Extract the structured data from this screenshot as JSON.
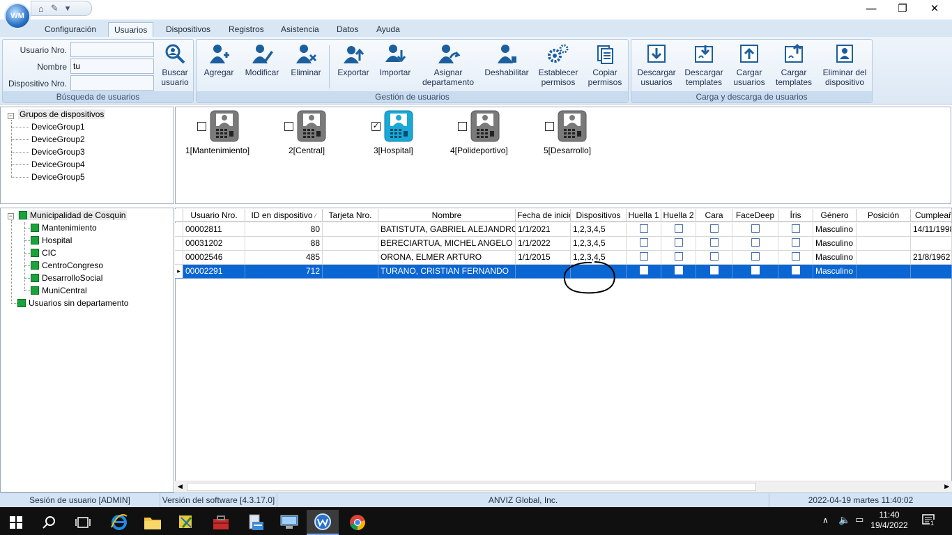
{
  "app": {
    "logo_text": "WM",
    "qat_icons": [
      "home-icon",
      "app-icon",
      "dropdown-icon"
    ]
  },
  "window_controls": {
    "minimize": "—",
    "maximize": "❐",
    "close": "✕"
  },
  "tabs": [
    "Configuración",
    "Usuarios",
    "Dispositivos",
    "Registros",
    "Asistencia",
    "Datos",
    "Ayuda"
  ],
  "active_tab": "Usuarios",
  "search": {
    "caption": "Búsqueda de usuarios",
    "user_label": "Usuario Nro.",
    "user_value": "",
    "name_label": "Nombre",
    "name_value": "tu",
    "device_label": "Dispositivo Nro.",
    "device_value": "",
    "button_line1": "Buscar",
    "button_line2": "usuario"
  },
  "management": {
    "caption": "Gestión de usuarios",
    "buttons": [
      {
        "line1": "Agregar",
        "line2": ""
      },
      {
        "line1": "Modificar",
        "line2": ""
      },
      {
        "line1": "Eliminar",
        "line2": ""
      },
      {
        "line1": "Exportar",
        "line2": ""
      },
      {
        "line1": "Importar",
        "line2": ""
      },
      {
        "line1": "Asignar",
        "line2": "departamento"
      },
      {
        "line1": "Deshabilitar",
        "line2": ""
      },
      {
        "line1": "Establecer",
        "line2": "permisos"
      },
      {
        "line1": "Copiar",
        "line2": "permisos"
      }
    ]
  },
  "transfer": {
    "caption": "Carga y descarga de usuarios",
    "buttons": [
      {
        "line1": "Descargar",
        "line2": "usuarios"
      },
      {
        "line1": "Descargar",
        "line2": "templates"
      },
      {
        "line1": "Cargar",
        "line2": "usuarios"
      },
      {
        "line1": "Cargar",
        "line2": "templates"
      },
      {
        "line1": "Eliminar del",
        "line2": "dispositivo"
      }
    ]
  },
  "device_groups": {
    "root": "Grupos de dispositivos",
    "items": [
      "DeviceGroup1",
      "DeviceGroup2",
      "DeviceGroup3",
      "DeviceGroup4",
      "DeviceGroup5"
    ]
  },
  "devices": [
    {
      "label": "1[Mantenimiento]",
      "checked": false
    },
    {
      "label": "2[Central]",
      "checked": false
    },
    {
      "label": "3[Hospital]",
      "checked": true
    },
    {
      "label": "4[Polideportivo]",
      "checked": false
    },
    {
      "label": "5[Desarrollo]",
      "checked": false
    }
  ],
  "departments": {
    "root": "Municipalidad de Cosquin",
    "items": [
      "Mantenimiento",
      "Hospital",
      "CIC",
      "CentroCongreso",
      "DesarrolloSocial",
      "MuniCentral"
    ],
    "no_dept": "Usuarios sin departamento"
  },
  "grid": {
    "columns": [
      "Usuario Nro.",
      "ID en dispositivo",
      "Tarjeta Nro.",
      "Nombre",
      "Fecha de inicio",
      "Dispositivos",
      "Huella 1",
      "Huella 2",
      "Cara",
      "FaceDeep",
      "Íris",
      "Género",
      "Posición",
      "Cumpleaños"
    ],
    "rows": [
      {
        "user": "00002811",
        "id": "80",
        "card": "",
        "name": "BATISTUTA, GABRIEL ALEJANDRO",
        "start": "1/1/2021",
        "devices": "1,2,3,4,5",
        "gender": "Masculino",
        "position": "",
        "birthday": "14/11/1998"
      },
      {
        "user": "00031202",
        "id": "88",
        "card": "",
        "name": "BERECIARTUA, MICHEL ANGELO",
        "start": "1/1/2022",
        "devices": "1,2,3,4,5",
        "gender": "Masculino",
        "position": "",
        "birthday": ""
      },
      {
        "user": "00002546",
        "id": "485",
        "card": "",
        "name": "ORONA, ELMER ARTURO",
        "start": "1/1/2015",
        "devices": "1,2,3,4,5",
        "gender": "Masculino",
        "position": "",
        "birthday": "21/8/1962"
      },
      {
        "user": "00002291",
        "id": "712",
        "card": "",
        "name": "TURANO, CRISTIAN FERNANDO",
        "start": "",
        "devices": "",
        "gender": "Masculino",
        "position": "",
        "birthday": ""
      }
    ],
    "selected_row": 3
  },
  "status": {
    "session": "Sesión de usuario  [ADMIN]",
    "version": "Versión del software  [4.3.17.0]",
    "company": "ANVIZ Global, Inc.",
    "datetime": "2022-04-19 martes 11:40:02"
  },
  "taskbar": {
    "time": "11:40",
    "date": "19/4/2022",
    "notifications": "1"
  }
}
